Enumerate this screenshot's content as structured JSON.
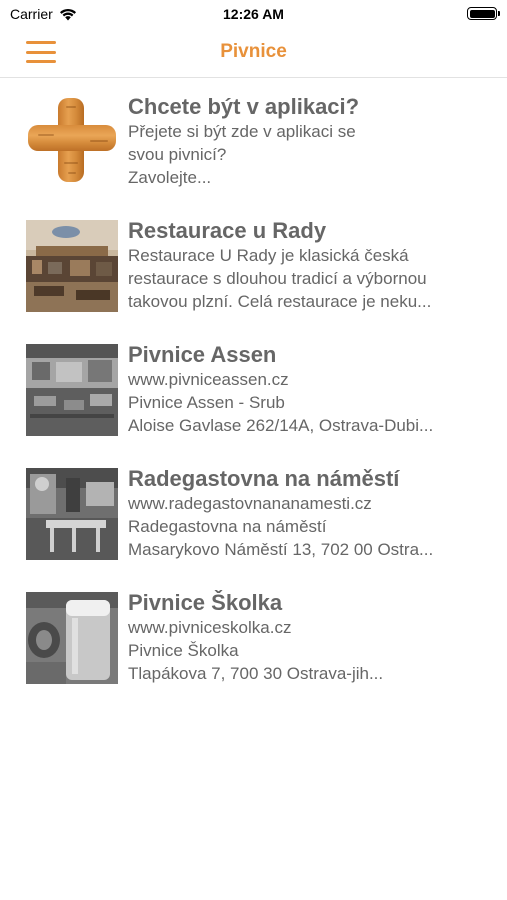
{
  "status_bar": {
    "carrier": "Carrier",
    "time": "12:26 AM",
    "icons": [
      "wifi-icon",
      "battery-icon"
    ]
  },
  "nav": {
    "title": "Pivnice",
    "menu_icon": "hamburger-menu-icon",
    "accent_color": "#e8913a"
  },
  "items": [
    {
      "title": "Chcete být v aplikaci?",
      "lines": [
        "Přejete si být zde v aplikaci se",
        "svou pivnicí?",
        "Zavolejte..."
      ],
      "image": "wooden-plus-icon"
    },
    {
      "title": "Restaurace u Rady",
      "lines": [
        "Restaurace U Rady je klasická česká",
        "restaurace s dlouhou tradicí a výbornou",
        "takovou plzní. Celá restaurace je neku..."
      ],
      "image": "restaurant-interior-photo"
    },
    {
      "title": "Pivnice Assen",
      "lines": [
        "www.pivniceassen.cz",
        "Pivnice Assen - Srub",
        "Aloise Gavlase 262/14A, Ostrava-Dubi..."
      ],
      "image": "pub-interior-photo"
    },
    {
      "title": "Radegastovna na náměstí",
      "lines": [
        "www.radegastovnananamesti.cz",
        "Radegastovna na náměstí",
        "Masarykovo Náměstí 13, 702 00 Ostra..."
      ],
      "image": "pub-interior-photo"
    },
    {
      "title": "Pivnice Školka",
      "lines": [
        "www.pivniceskolka.cz",
        "Pivnice Školka",
        "Tlapákova 7, 700 30 Ostrava-jih..."
      ],
      "image": "beer-glass-photo"
    }
  ]
}
